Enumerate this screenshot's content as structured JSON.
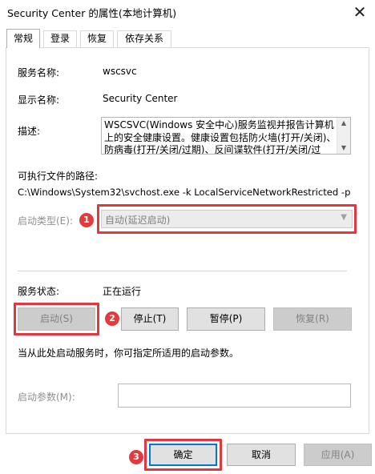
{
  "window": {
    "title": "Security Center 的属性(本地计算机)",
    "close_glyph": "✕"
  },
  "tabs": [
    {
      "label": "常规",
      "active": true
    },
    {
      "label": "登录",
      "active": false
    },
    {
      "label": "恢复",
      "active": false
    },
    {
      "label": "依存关系",
      "active": false
    }
  ],
  "general": {
    "service_name_label": "服务名称:",
    "service_name_value": "wscsvc",
    "display_name_label": "显示名称:",
    "display_name_value": "Security Center",
    "description_label": "描述:",
    "description_value": "WSCSVC(Windows 安全中心)服务监视并报告计算机上的安全健康设置。健康设置包括防火墙(打开/关闭)、防病毒(打开/关闭/过期)、反间谍软件(打开/关闭/过",
    "exe_path_label": "可执行文件的路径:",
    "exe_path_value": "C:\\Windows\\System32\\svchost.exe -k LocalServiceNetworkRestricted -p",
    "startup_type_label": "启动类型(E):",
    "startup_type_value": "自动(延迟启动)",
    "status_label": "服务状态:",
    "status_value": "正在运行",
    "hint_text": "当从此处启动服务时，你可指定所适用的启动参数。",
    "start_params_label": "启动参数(M):",
    "start_params_value": ""
  },
  "service_buttons": {
    "start": "启动(S)",
    "stop": "停止(T)",
    "pause": "暂停(P)",
    "resume": "恢复(R)"
  },
  "dialog_buttons": {
    "ok": "确定",
    "cancel": "取消",
    "apply": "应用(A)"
  },
  "annotations": {
    "marker_1": "1",
    "marker_2": "2",
    "marker_3": "3",
    "highlight_color": "#e0383e"
  },
  "icons": {
    "close": "close-icon",
    "scroll_up": "scroll-up-icon",
    "scroll_down": "scroll-down-icon",
    "dropdown": "chevron-down-icon"
  }
}
